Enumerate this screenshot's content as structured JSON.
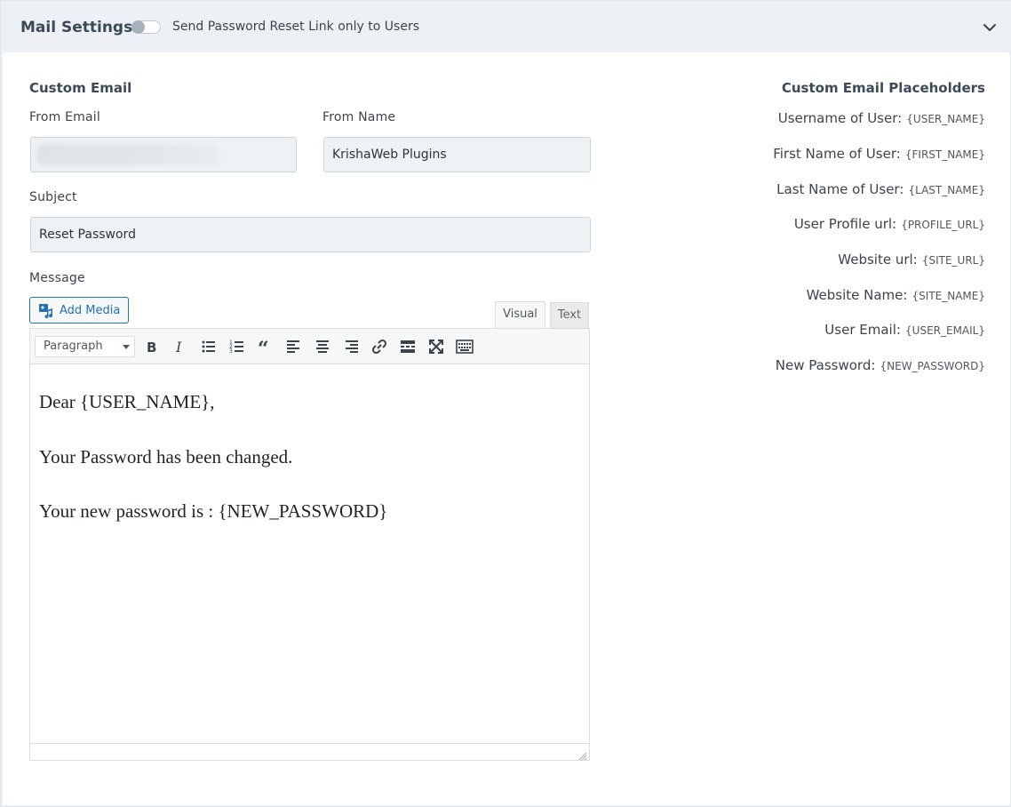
{
  "header": {
    "title": "Mail Settings",
    "toggle_label": "Send Password Reset Link only to Users",
    "toggle_on": false
  },
  "custom_email": {
    "title": "Custom Email",
    "from_email": {
      "label": "From Email",
      "value": ""
    },
    "from_name": {
      "label": "From Name",
      "value": "KrishaWeb Plugins"
    },
    "subject": {
      "label": "Subject",
      "value": "Reset Password"
    },
    "message": {
      "label": "Message",
      "add_media_label": "Add Media",
      "tabs": {
        "visual": "Visual",
        "text": "Text"
      },
      "format_select": "Paragraph",
      "lines": [
        "Dear {USER_NAME},",
        "Your Password has been changed.",
        "Your new password is : {NEW_PASSWORD}"
      ]
    }
  },
  "placeholders": {
    "title": "Custom Email Placeholders",
    "items": [
      {
        "label": "Username of User:",
        "code": "{USER_NAME}"
      },
      {
        "label": "First Name of User:",
        "code": "{FIRST_NAME}"
      },
      {
        "label": "Last Name of User:",
        "code": "{LAST_NAME}"
      },
      {
        "label": "User Profile url:",
        "code": "{PROFILE_URL}"
      },
      {
        "label": "Website url:",
        "code": "{SITE_URL}"
      },
      {
        "label": "Website Name:",
        "code": "{SITE_NAME}"
      },
      {
        "label": "User Email:",
        "code": "{USER_EMAIL}"
      },
      {
        "label": "New Password:",
        "code": "{NEW_PASSWORD}"
      }
    ]
  },
  "colors": {
    "accent": "#2271b1",
    "header_bg": "#edf1f5",
    "input_bg": "#eef2f5",
    "text": "#3c434a"
  }
}
